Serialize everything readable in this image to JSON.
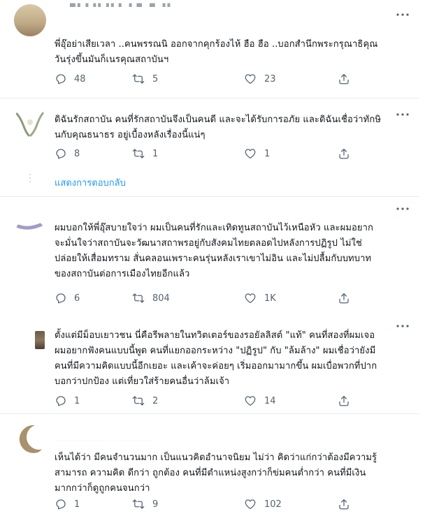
{
  "colors": {
    "accent": "#1d9bf0",
    "icon": "#536471",
    "divider": "#e6ecf0",
    "text": "#0f1419"
  },
  "tweets": [
    {
      "lines": [
        "พี่อุ๊อย่าเสียเวลา ..คนพรรณนิ ออกจากคุกร้องไห้ ฮือ ฮือ ..บอกสำนึกพระกรุณาธิคุณ",
        "วันรุ่งขึ้นมันก็เนรคุณสถาบันฯ"
      ],
      "reply_count": "48",
      "retweet_count": "5",
      "like_count": "23"
    },
    {
      "lines": [
        "ดิฉันรักสถาบัน คนที่รักสถาบันจึงเป็นคนดี และจะได้รับการอภัย และดิฉันเชื่อว่าทักษิ",
        "นกับคุณธนาธร อยู่เบื้องหลังเรื่องนี้แน่ๆ"
      ],
      "reply_count": "8",
      "retweet_count": "1",
      "like_count": "1",
      "show_replies": "แสดงการตอบกลับ"
    },
    {
      "lines": [
        "ผมบอกให้พี่อุ๊สบายใจว่า ผมเป็นคนที่รักและเทิดทูนสถาบันไว้เหนือหัว และผมอยาก",
        "จะมั่นใจว่าสถาบันจะวัฒนาสถาพรอยู่กับสังคมไทยตลอดไปหลังการปฏิรูป ไม่ใช่",
        "ปล่อยให้เสื่อมทราม สั่นคลอนเพราะคนรุ่นหลังเราเขาไม่อิน และไม่ปลื้มกับบทบาท",
        "ของสถาบันต่อการเมืองไทยอีกแล้ว"
      ],
      "reply_count": "6",
      "retweet_count": "804",
      "like_count": "1K"
    },
    {
      "lines": [
        "ตั้งแต่มีม็อบเยาวชน นี่คือรีพลายในทวิตเตอร์ของรอยัลลิสต์ \"แท้\" คนที่สองที่ผมเจอ",
        "ผมอยากฟังคนแบบนี้พูด คนที่แยกออกระหว่าง \"ปฏิรูป\" กับ \"ล้มล้าง\" ผมเชื่อว่ายังมี",
        "คนที่มีความคิดแบบนี้อีกเยอะ และเค้าจะค่อยๆ เริ่มออกมามากขึ้น ผมเบื่อพวกที่ปาก",
        "บอกว่าปกป้อง แต่เที่ยวใส่ร้ายคนอื่นว่าล้มเจ้า"
      ],
      "reply_count": "1",
      "retweet_count": "2",
      "like_count": "14"
    },
    {
      "lines": [
        "เห็นได้ว่า มีคนจำนวนมาก เป็นแนวคิดอำนาจนิยม ไม่ว่า คิดว่าแก่กว่าต้องมีความรู้",
        "สามารถ ความคิด ดีกว่า ถูกต้อง     คนที่มีตำแหน่งสูงกว่าก็ข่มคนต่ำกว่า   คนที่มีเงิน",
        "มากกว่าก็ดูถูกคนจนกว่า"
      ],
      "reply_count": "1",
      "retweet_count": "9",
      "like_count": "102"
    }
  ]
}
